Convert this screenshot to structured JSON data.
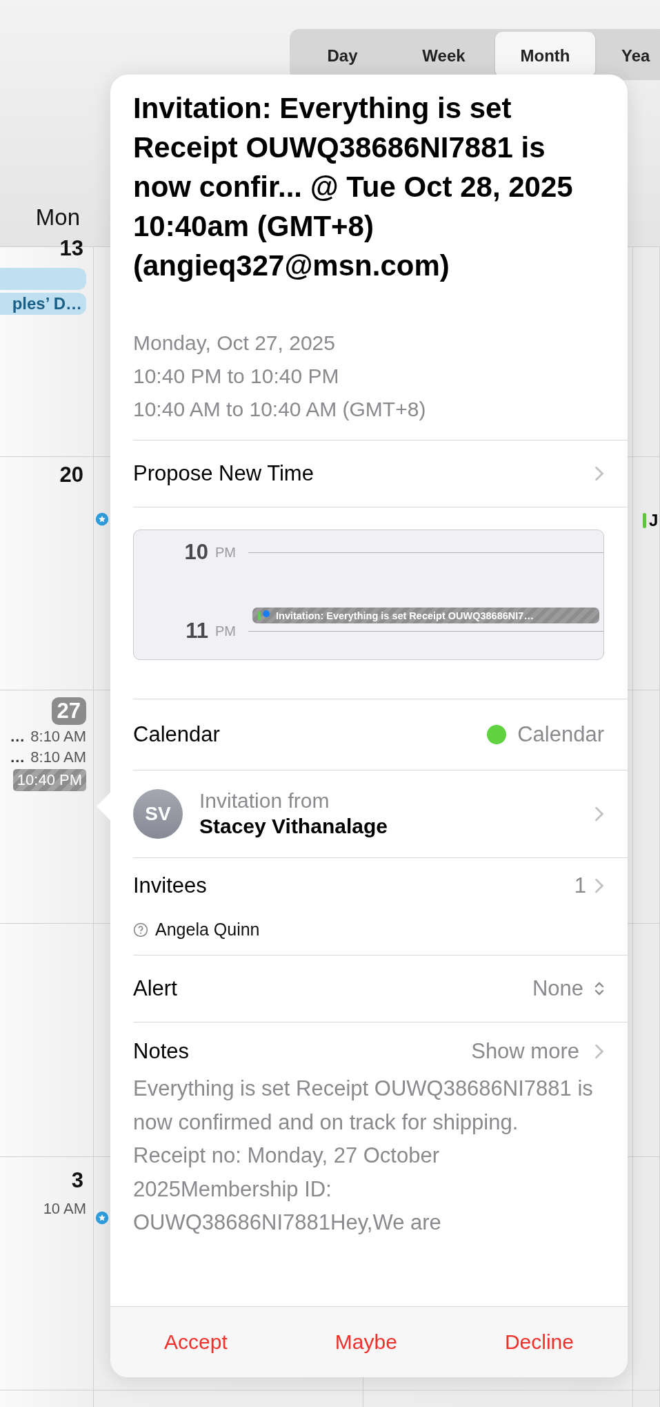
{
  "calendar": {
    "view_tabs": [
      {
        "label": "Day",
        "selected": false
      },
      {
        "label": "Week",
        "selected": false
      },
      {
        "label": "Month",
        "selected": true
      },
      {
        "label": "Yea",
        "selected": false
      }
    ],
    "weekday_header": "Mon",
    "weeks": [
      {
        "day": "13",
        "highlighted": false,
        "events": [
          {
            "kind": "bar",
            "color": "#bfe0f1"
          },
          {
            "kind": "bar",
            "title": "ples’ D…",
            "color": "#bfe0f1"
          }
        ]
      },
      {
        "day": "20",
        "highlighted": false
      },
      {
        "day": "27",
        "highlighted": true,
        "events": [
          {
            "kind": "timed",
            "title": "…",
            "time": "8:10 AM"
          },
          {
            "kind": "timed",
            "title": "…",
            "time": "8:10 AM"
          },
          {
            "kind": "tentative",
            "time": "10:40 PM"
          }
        ]
      },
      {
        "day": "3",
        "highlighted": false,
        "events": [
          {
            "kind": "timed",
            "time": "10 AM"
          }
        ]
      }
    ],
    "right_column_events": [
      {
        "title": "J",
        "color": "#5ac83a"
      }
    ]
  },
  "popover": {
    "title": "Invitation: Everything is set Receipt OUWQ38686NI7881 is now confir... @ Tue Oct 28, 2025 10:40am (GMT+8) (angieq327@msn.com)",
    "date_lines": [
      "Monday, Oct 27, 2025",
      "10:40 PM to 10:40 PM",
      "10:40 AM to 10:40 AM (GMT+8)"
    ],
    "propose_label": "Propose New Time",
    "timeline": {
      "hours": [
        {
          "hour": "10",
          "period": "PM"
        },
        {
          "hour": "11",
          "period": "PM"
        }
      ],
      "event": {
        "title": "Invitation: Everything is set   Receipt OUWQ38686NI7…"
      }
    },
    "calendar_row": {
      "label": "Calendar",
      "value": "Calendar",
      "color": "#5ed33f"
    },
    "organizer": {
      "initials": "SV",
      "caption": "Invitation from",
      "name": "Stacey Vithanalage"
    },
    "invitees": {
      "label": "Invitees",
      "count": "1",
      "people": [
        {
          "name": "Angela Quinn"
        }
      ]
    },
    "alert": {
      "label": "Alert",
      "value": "None"
    },
    "notes": {
      "label": "Notes",
      "action": "Show more",
      "text": "Everything is set Receipt OUWQ38686NI7881 is now confirmed and on track for shipping.\nReceipt no: Monday, 27 October 2025Membership ID: OUWQ38686NI7881Hey,We are"
    },
    "actions": [
      "Accept",
      "Maybe",
      "Decline"
    ]
  }
}
